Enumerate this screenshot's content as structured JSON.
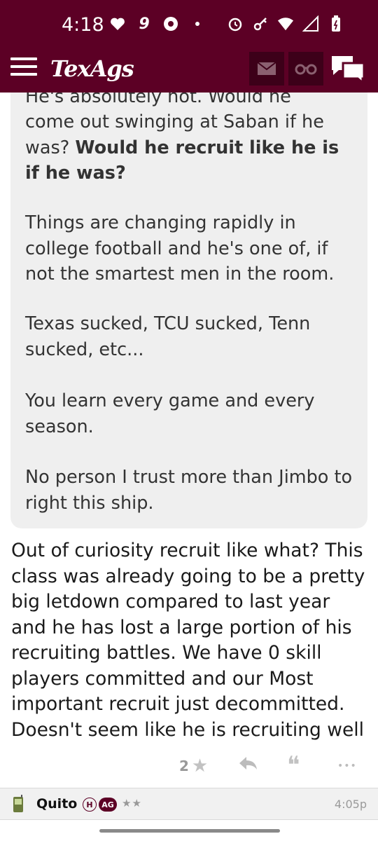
{
  "status_bar": {
    "time": "4:18",
    "icons_left": [
      "heart-icon",
      "nine-icon",
      "chrome-icon",
      "dot-icon"
    ],
    "icons_right": [
      "alarm-icon",
      "key-icon",
      "wifi-icon",
      "signal-icon",
      "battery-icon"
    ]
  },
  "header": {
    "logo": "TexAgs",
    "brand_color": "#5c0025"
  },
  "quote": {
    "cutoff_line": "He's absolutely not. Would he",
    "para1_normal": "come out swinging at Saban if he was? ",
    "para1_bold": "Would he recruit like he is if he was?",
    "para2": "Things are changing rapidly in college football and he's one of, if not the smartest men in the room.",
    "para3": "Texas sucked, TCU sucked, Tenn sucked, etc...",
    "para4": "You learn every game and every season.",
    "para5": "No person I trust more than Jimbo to right this ship."
  },
  "reply": {
    "text": "Out of curiosity recruit like what? This class was already going to be a pretty big letdown compared to last year and he has lost a large portion of his recruiting battles. We have 0 skill players committed and our Most important recruit just decommitted. Doesn't seem like he is recruiting well"
  },
  "actions": {
    "like_count": "2",
    "like_icon": "★",
    "quote_icon": "❝",
    "more_icon": "•••"
  },
  "next_post": {
    "username": "Quito",
    "badge_h": "H",
    "badge_ag": "AG",
    "stars": "★★",
    "time": "4:05p"
  }
}
